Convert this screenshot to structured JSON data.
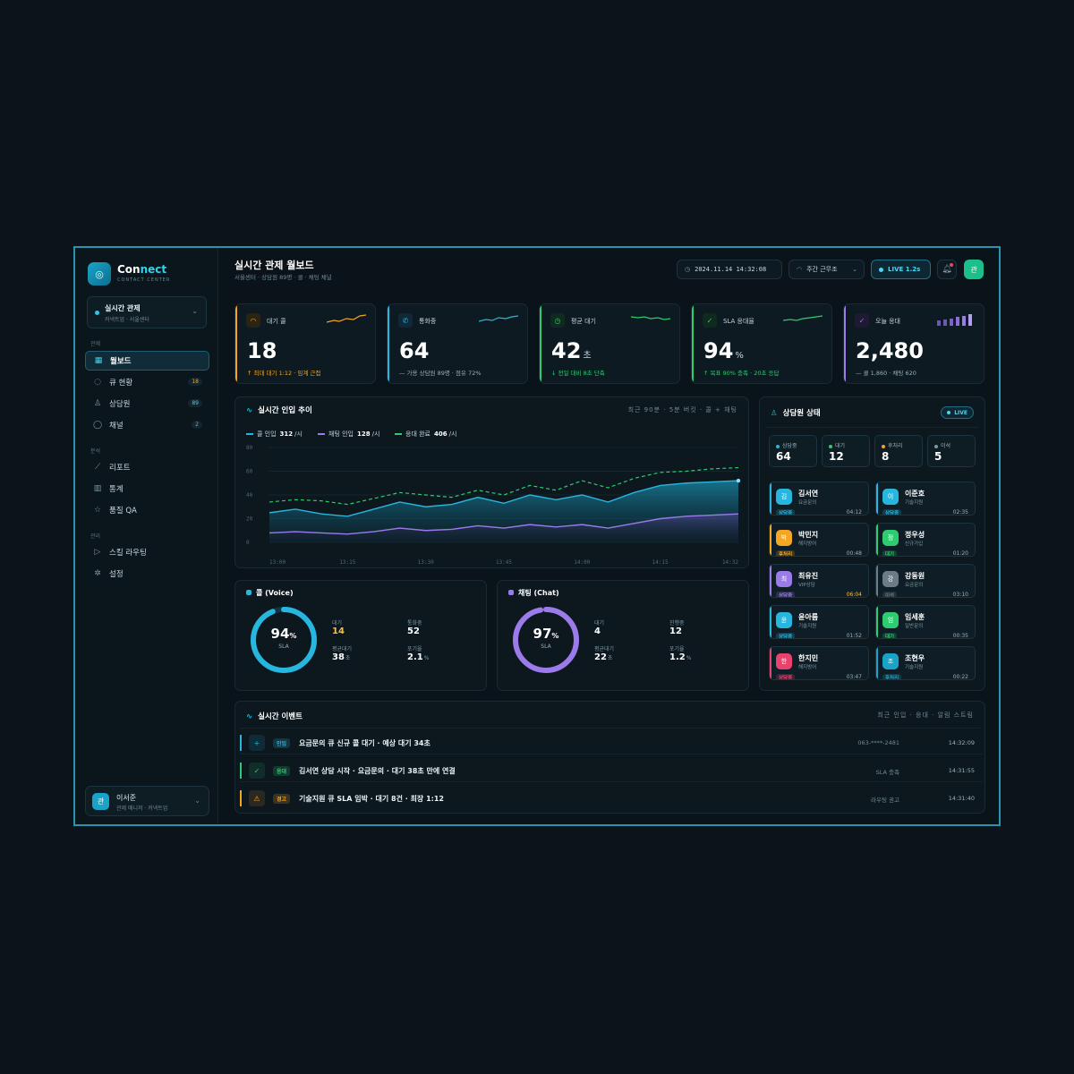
{
  "brand": {
    "name_a": "Con",
    "name_b": "nect",
    "sub": "CONTACT CENTER"
  },
  "workspace": {
    "title": "실시간 관제",
    "sub": "커넥트업 · 서울센터"
  },
  "nav": {
    "sec_monitor": "관제",
    "sec_analysis": "분석",
    "sec_manage": "관리",
    "items": [
      {
        "label": "월보드",
        "badge": ""
      },
      {
        "label": "큐 현황",
        "badge": "18"
      },
      {
        "label": "상담원",
        "badge": "89"
      },
      {
        "label": "채널",
        "badge": "2"
      },
      {
        "label": "리포트",
        "badge": ""
      },
      {
        "label": "통계",
        "badge": ""
      },
      {
        "label": "품질 QA",
        "badge": ""
      },
      {
        "label": "스킬 라우팅",
        "badge": ""
      },
      {
        "label": "설정",
        "badge": ""
      }
    ]
  },
  "user": {
    "avatar": "관",
    "name": "이서준",
    "role": "관제 매니저 · 커넥트업"
  },
  "header": {
    "title": "실시간 관제 월보드",
    "subtitle": "서울센터 · 상담원 89명 · 콜 · 채팅 채널",
    "datetime": "2024.11.14 14:32:08",
    "shift": "주간 근무조",
    "live": "LIVE 1.2s",
    "avatar": "관"
  },
  "kpis": [
    {
      "label": "대기 콜",
      "value": "18",
      "unit": "",
      "note": "↑ 최대 대기 1:12 · 임계 근접",
      "color": "#f5a524"
    },
    {
      "label": "통화중",
      "value": "64",
      "unit": "",
      "note": "— 가용 상담원 89명 · 점유 72%",
      "color": "#27b6dd"
    },
    {
      "label": "평균 대기",
      "value": "42",
      "unit": "초",
      "note": "↓ 전일 대비 8초 단축",
      "color": "#2ecc71"
    },
    {
      "label": "SLA 응대율",
      "value": "94",
      "unit": "%",
      "note": "↑ 목표 90% 충족 · 20초 응답",
      "color": "#2ecc71"
    },
    {
      "label": "오늘 응대",
      "value": "2,480",
      "unit": "",
      "note": "— 콜 1,860 · 채팅 620",
      "color": "#9b7bea"
    }
  ],
  "trend": {
    "title": "실시간 인입 추이",
    "meta": "최근 90분 · 5분 버킷 · 콜 + 채팅",
    "legend": [
      {
        "label": "콜 인입",
        "value": "312",
        "unit": "/시",
        "color": "#27b6dd"
      },
      {
        "label": "채팅 인입",
        "value": "128",
        "unit": "/시",
        "color": "#9b7bea"
      },
      {
        "label": "응대 완료",
        "value": "406",
        "unit": "/시",
        "color": "#2ecc71"
      }
    ]
  },
  "chart_data": {
    "type": "area",
    "x": [
      "13:00",
      "13:05",
      "13:10",
      "13:15",
      "13:20",
      "13:25",
      "13:30",
      "13:35",
      "13:40",
      "13:45",
      "13:50",
      "13:55",
      "14:00",
      "14:05",
      "14:10",
      "14:15",
      "14:20",
      "14:25",
      "14:32"
    ],
    "xticks": [
      "13:00",
      "13:15",
      "13:30",
      "13:45",
      "14:00",
      "14:15",
      "14:32"
    ],
    "yticks": [
      "0",
      "20",
      "40",
      "60",
      "80"
    ],
    "ylim": [
      0,
      80
    ],
    "series": [
      {
        "name": "콜 인입",
        "color": "#27b6dd",
        "values": [
          25,
          28,
          24,
          22,
          28,
          34,
          30,
          32,
          38,
          33,
          40,
          36,
          40,
          34,
          42,
          48,
          50,
          51,
          52
        ]
      },
      {
        "name": "채팅 인입",
        "color": "#9b7bea",
        "values": [
          8,
          9,
          8,
          7,
          9,
          12,
          10,
          11,
          14,
          12,
          15,
          13,
          15,
          12,
          16,
          20,
          22,
          23,
          24
        ]
      },
      {
        "name": "응대 완료",
        "color": "#2ecc71",
        "values": [
          34,
          36,
          35,
          32,
          37,
          42,
          40,
          38,
          44,
          40,
          48,
          44,
          52,
          46,
          54,
          59,
          60,
          62,
          63
        ]
      }
    ]
  },
  "voice": {
    "title": "콜 (Voice)",
    "pct": "94",
    "pct_unit": "%",
    "center_label": "SLA",
    "value": 0.94,
    "color": "#27b6dd",
    "stats": [
      {
        "label": "대기",
        "value": "14",
        "unit": "",
        "hl": true
      },
      {
        "label": "통화중",
        "value": "52",
        "unit": "",
        "hl": false
      },
      {
        "label": "평균대기",
        "value": "38",
        "unit": "초",
        "hl": false
      },
      {
        "label": "포기율",
        "value": "2.1",
        "unit": "%",
        "hl": false
      }
    ]
  },
  "chat": {
    "title": "채팅 (Chat)",
    "pct": "97",
    "pct_unit": "%",
    "center_label": "SLA",
    "value": 0.97,
    "color": "#9b7bea",
    "stats": [
      {
        "label": "대기",
        "value": "4",
        "unit": ""
      },
      {
        "label": "진행중",
        "value": "12",
        "unit": ""
      },
      {
        "label": "평균대기",
        "value": "22",
        "unit": "초"
      },
      {
        "label": "포기율",
        "value": "1.2",
        "unit": "%"
      }
    ]
  },
  "agents": {
    "title": "상담원 상태",
    "live": "LIVE",
    "counts": [
      {
        "label": "상담중",
        "value": "64",
        "color": "#27b6dd"
      },
      {
        "label": "대기",
        "value": "12",
        "color": "#2ecc71"
      },
      {
        "label": "후처리",
        "value": "8",
        "color": "#f5a524"
      },
      {
        "label": "이석",
        "value": "5",
        "color": "#7e98a4"
      }
    ],
    "list": [
      {
        "avatar": "김",
        "name": "김서연",
        "dept": "요금문의",
        "status": "상담중",
        "time": "04:12",
        "color": "#27b6dd",
        "warn": false
      },
      {
        "avatar": "이",
        "name": "이준호",
        "dept": "기술지원",
        "status": "상담중",
        "time": "02:35",
        "color": "#27b6dd",
        "warn": false
      },
      {
        "avatar": "박",
        "name": "박민지",
        "dept": "해지방어",
        "status": "후처리",
        "time": "00:48",
        "color": "#f5a524",
        "warn": false
      },
      {
        "avatar": "정",
        "name": "정우성",
        "dept": "신규가입",
        "status": "대기",
        "time": "01:20",
        "color": "#2ecc71",
        "warn": false
      },
      {
        "avatar": "최",
        "name": "최유진",
        "dept": "VIP상담",
        "status": "상담중",
        "time": "06:04",
        "color": "#9b7bea",
        "warn": true
      },
      {
        "avatar": "강",
        "name": "강동원",
        "dept": "요금문의",
        "status": "이석",
        "time": "03:10",
        "color": "#6b7c86",
        "warn": false
      },
      {
        "avatar": "윤",
        "name": "윤아름",
        "dept": "기술지원",
        "status": "상담중",
        "time": "01:52",
        "color": "#27b6dd",
        "warn": false
      },
      {
        "avatar": "임",
        "name": "임세훈",
        "dept": "일반문의",
        "status": "대기",
        "time": "00:35",
        "color": "#2ecc71",
        "warn": false
      },
      {
        "avatar": "한",
        "name": "한지민",
        "dept": "해지방어",
        "status": "상담중",
        "time": "03:47",
        "color": "#e8436e",
        "warn": false
      },
      {
        "avatar": "조",
        "name": "조현우",
        "dept": "기술지원",
        "status": "후처리",
        "time": "00:22",
        "color": "#1aa3c8",
        "warn": false
      }
    ]
  },
  "events": {
    "title": "실시간 이벤트",
    "meta": "최근 인입 · 응대 · 알림 스트림",
    "items": [
      {
        "icon": "+",
        "tag": "인입",
        "msg": "요금문의 큐 신규 콜 대기 · 예상 대기 34초",
        "sub": "063-****-2481",
        "time": "14:32:09",
        "color": "#27b6dd"
      },
      {
        "icon": "✓",
        "tag": "응대",
        "msg": "김서연 상담 시작 · 요금문의 · 대기 38초 만에 연결",
        "sub": "SLA 충족",
        "time": "14:31:55",
        "color": "#2ecc71"
      },
      {
        "icon": "⚠",
        "tag": "경고",
        "msg": "기술지원 큐 SLA 임박 · 대기 8건 · 최장 1:12",
        "sub": "라우팅 권고",
        "time": "14:31:40",
        "color": "#f5a524"
      }
    ]
  }
}
